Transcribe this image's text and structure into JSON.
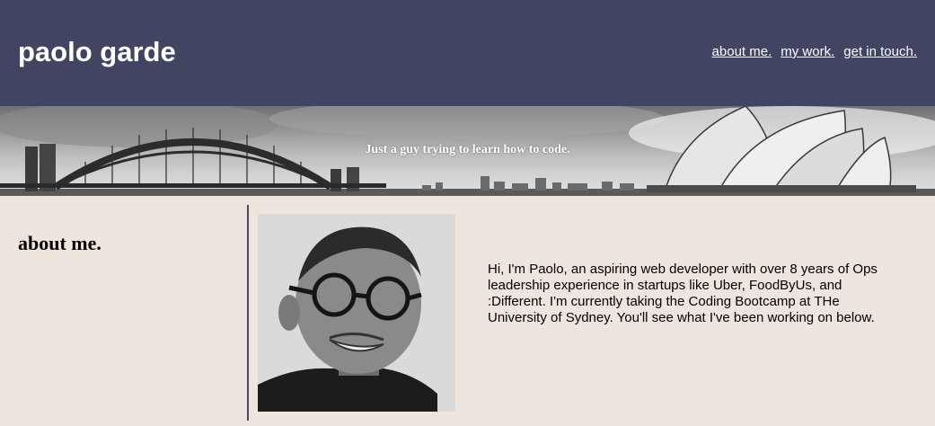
{
  "header": {
    "brand": "paolo garde",
    "nav": [
      {
        "label": "about me."
      },
      {
        "label": "my work."
      },
      {
        "label": "get in touch."
      }
    ],
    "background_color": "#414562"
  },
  "hero": {
    "tagline": "Just a guy trying to learn how to code."
  },
  "about": {
    "heading": "about me.",
    "bio": "Hi, I'm Paolo, an aspiring web developer with over 8 years of Ops leadership experience in startups like Uber, FoodByUs, and :Different. I'm currently taking the Coding Bootcamp at THe University of Sydney. You'll see what I've been working on below.",
    "background_color": "#efe5df"
  }
}
